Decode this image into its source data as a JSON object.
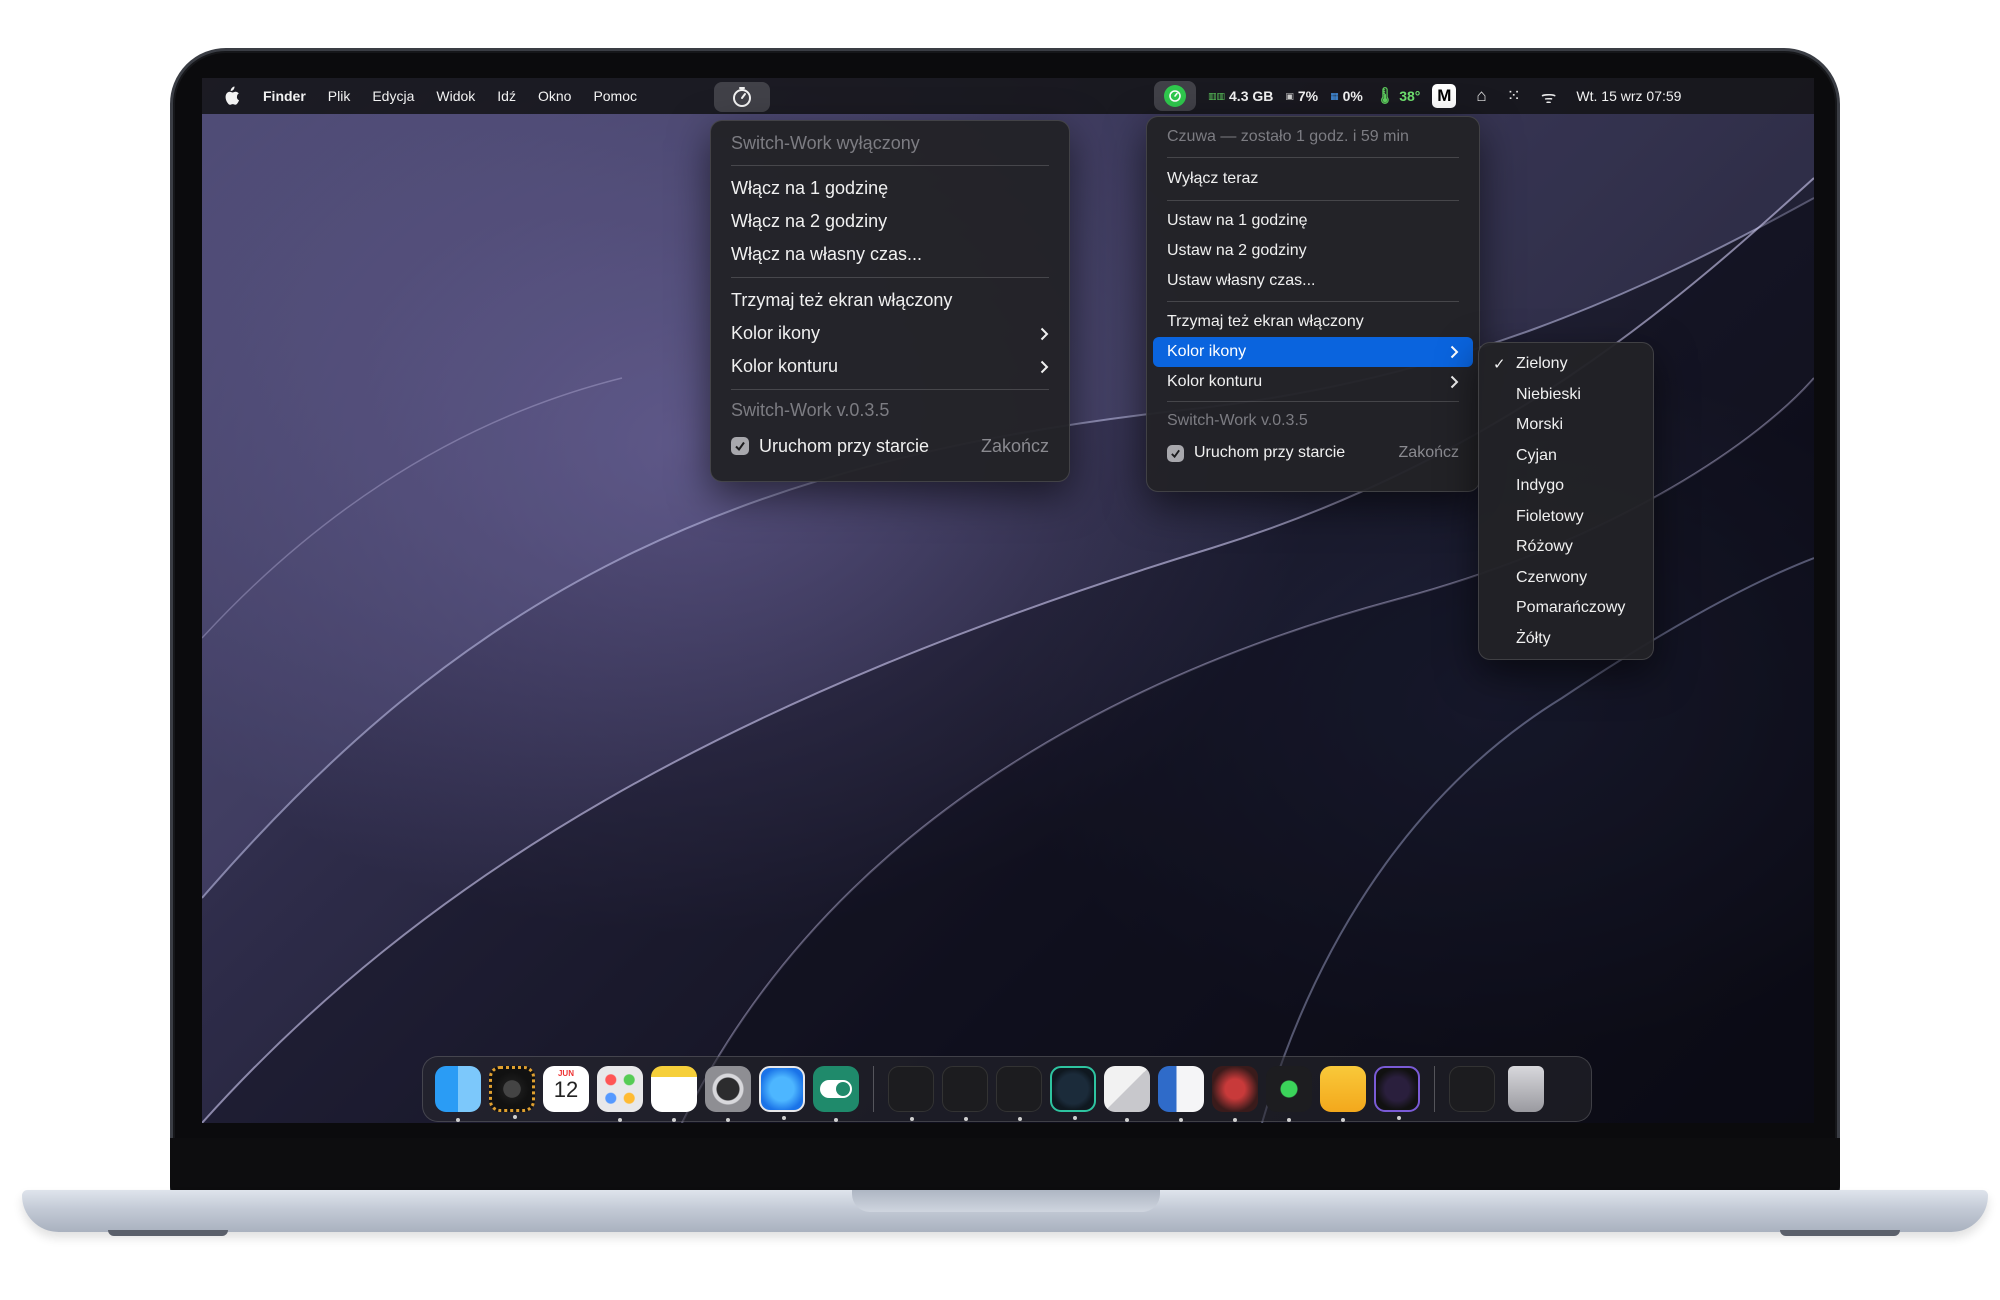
{
  "menubar": {
    "items": [
      "Finder",
      "Plik",
      "Edycja",
      "Widok",
      "Idź",
      "Okno",
      "Pomoc"
    ],
    "memory": "4.3 GB",
    "cpu": "7%",
    "network": "0%",
    "temperature": "38°",
    "badge": "M",
    "datetime": "Wt. 15 wrz  07:59"
  },
  "menu_left": {
    "status": "Switch-Work wyłączony",
    "enable_1h": "Włącz na 1 godzinę",
    "enable_2h": "Włącz na 2 godziny",
    "enable_custom": "Włącz na własny czas...",
    "keep_screen": "Trzymaj też ekran włączony",
    "icon_color": "Kolor ikony",
    "outline_color": "Kolor konturu",
    "version": "Switch-Work v.0.3.5",
    "launch_at_login": "Uruchom przy starcie",
    "quit": "Zakończ"
  },
  "menu_right": {
    "status": "Czuwa — zostało 1 godz. i 59 min",
    "turn_off_now": "Wyłącz teraz",
    "set_1h": "Ustaw na 1 godzinę",
    "set_2h": "Ustaw na 2 godziny",
    "set_custom": "Ustaw własny czas...",
    "keep_screen": "Trzymaj też ekran włączony",
    "icon_color": "Kolor ikony",
    "outline_color": "Kolor konturu",
    "version": "Switch-Work v.0.3.5",
    "launch_at_login": "Uruchom przy starcie",
    "quit": "Zakończ"
  },
  "color_submenu": {
    "selected": "Zielony",
    "options": [
      "Zielony",
      "Niebieski",
      "Morski",
      "Cyjan",
      "Indygo",
      "Fioletowy",
      "Różowy",
      "Czerwony",
      "Pomarańczowy",
      "Żółty"
    ]
  },
  "dock": {
    "calendar_month": "JUN",
    "calendar_day": "12"
  },
  "colors": {
    "accent": "#0a64de",
    "status_green": "#2fc94d"
  }
}
